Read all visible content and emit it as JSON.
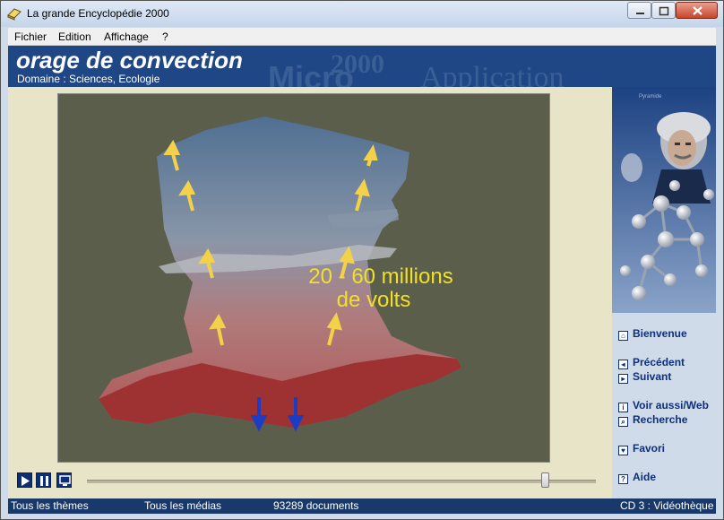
{
  "window": {
    "title": "La grande Encyclopédie 2000"
  },
  "menu": {
    "items": [
      "Fichier",
      "Edition",
      "Affichage",
      "?"
    ]
  },
  "banner": {
    "topic_title": "orage de convection",
    "domain": "Domaine : Sciences, Ecologie",
    "watermark_year": "2000",
    "watermark_micro": "Micro",
    "watermark_app": "Application"
  },
  "media": {
    "caption_line1": "20 - 60 millions",
    "caption_line2": "de volts",
    "slider_position": 0.9
  },
  "side_image": {
    "label": "Pyramide"
  },
  "sidebar": {
    "bienvenue": "Bienvenue",
    "precedent": "Précédent",
    "suivant": "Suivant",
    "voir_aussi": "Voir aussi/Web",
    "recherche": "Recherche",
    "favori": "Favori",
    "aide": "Aide"
  },
  "status": {
    "themes": "Tous les thèmes",
    "medias": "Tous les médias",
    "documents": "93289 documents",
    "cd": "CD 3 : Vidéothèque"
  },
  "colors": {
    "banner": "#1f4786",
    "content": "#e7e4c8",
    "status": "#19396a",
    "nav": "#0f2f7a"
  }
}
